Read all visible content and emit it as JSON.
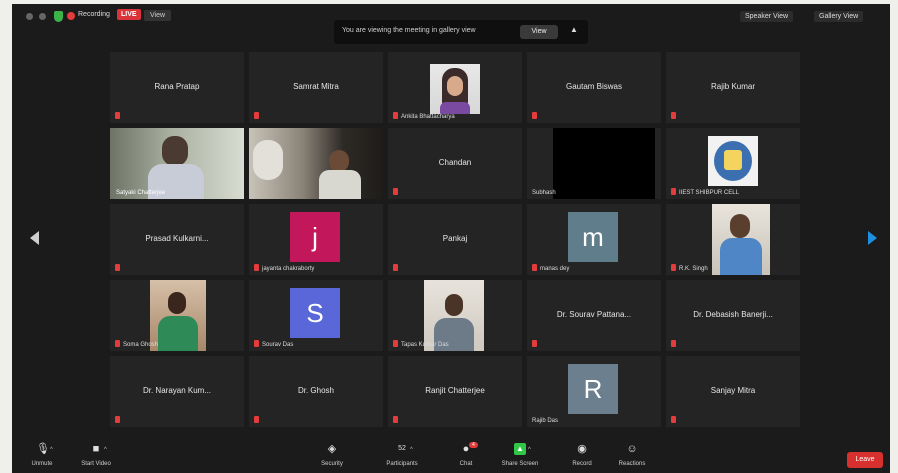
{
  "top_bar": {
    "recording_label": "Recording",
    "live_badge": "LIVE",
    "view_label": "View",
    "speaker_view": "Speaker View",
    "gallery_view": "Gallery View"
  },
  "banner": {
    "text": "You are viewing the meeting in gallery view",
    "button": "View"
  },
  "participants": [
    {
      "name": "Rana Pratap",
      "type": "name"
    },
    {
      "name": "Samrat Mitra",
      "type": "name"
    },
    {
      "name": "",
      "caption": "Ankita Bhattacharya",
      "type": "photo"
    },
    {
      "name": "Gautam Biswas",
      "type": "name"
    },
    {
      "name": "Rajib Kumar",
      "type": "name"
    },
    {
      "name": "",
      "caption": "Satyaki Chatterjee",
      "type": "video"
    },
    {
      "name": "",
      "caption": "",
      "type": "video"
    },
    {
      "name": "Chandan",
      "type": "name"
    },
    {
      "name": "",
      "caption": "Subhash",
      "type": "black"
    },
    {
      "name": "",
      "caption": "IIEST SHIBPUR CELL",
      "type": "logo"
    },
    {
      "name": "Prasad Kulkarni...",
      "type": "name"
    },
    {
      "name": "",
      "caption": "jayanta chakraborty",
      "type": "avatar",
      "letter": "j"
    },
    {
      "name": "Pankaj",
      "type": "name"
    },
    {
      "name": "",
      "caption": "manas dey",
      "type": "avatar",
      "letter": "m"
    },
    {
      "name": "",
      "caption": "R.K. Singh",
      "type": "video"
    },
    {
      "name": "",
      "caption": "Soma Ghosh",
      "type": "video"
    },
    {
      "name": "",
      "caption": "Sourav Das",
      "type": "avatar",
      "letter": "S"
    },
    {
      "name": "",
      "caption": "Tapas Kumar Das",
      "type": "video"
    },
    {
      "name": "Dr. Sourav Pattana...",
      "type": "name"
    },
    {
      "name": "Dr. Debasish Banerji...",
      "type": "name"
    },
    {
      "name": "Dr. Narayan Kum...",
      "type": "name"
    },
    {
      "name": "Dr. Ghosh",
      "type": "name"
    },
    {
      "name": "Ranjit Chatterjee",
      "type": "name"
    },
    {
      "name": "",
      "caption": "Rajib Das",
      "type": "avatar",
      "letter": "R"
    },
    {
      "name": "Sanjay Mitra",
      "type": "name"
    }
  ],
  "toolbar": {
    "unmute": "Unmute",
    "start_video": "Start Video",
    "security": "Security",
    "participants": "Participants",
    "participants_count": "52",
    "chat": "Chat",
    "chat_badge": "4",
    "share_screen": "Share Screen",
    "record": "Record",
    "reactions": "Reactions",
    "end": "Leave"
  },
  "colors": {
    "avatar_j": "#c2185b",
    "avatar_m": "#607d8b",
    "avatar_s": "#5a67d8",
    "avatar_r": "#6b7f8f",
    "share_green": "#33c748",
    "end_red": "#d7312f",
    "active_speaker": "#cfe04a",
    "next_arrow": "#1e8ee0"
  }
}
